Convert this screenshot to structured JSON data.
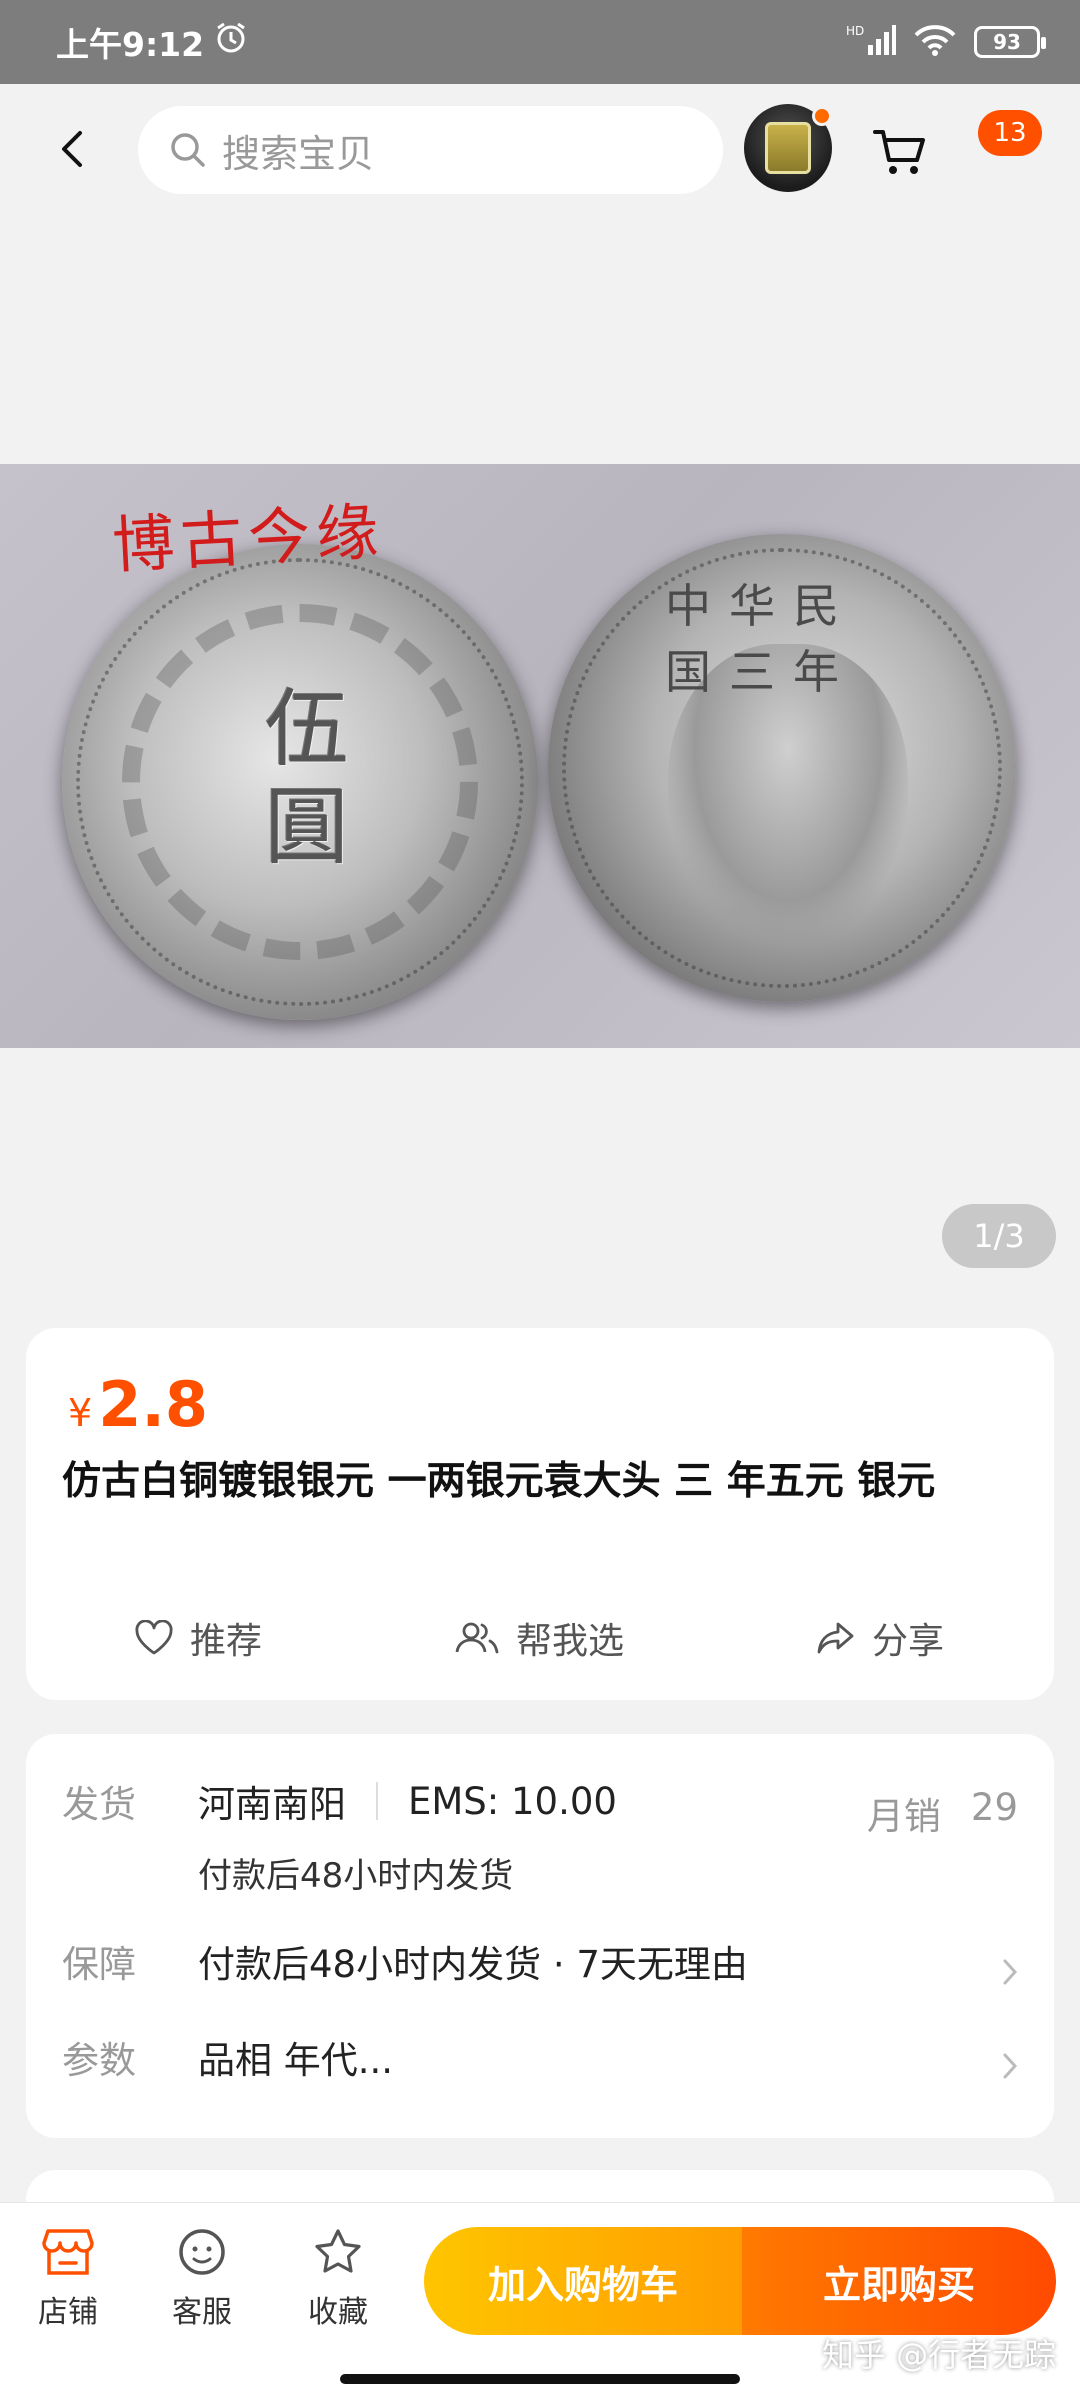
{
  "status_bar": {
    "time": "上午9:12",
    "battery": "93",
    "icons": [
      "alarm-icon",
      "signal-icon",
      "wifi-icon",
      "battery-icon"
    ]
  },
  "header": {
    "search_placeholder": "搜索宝贝",
    "cart_badge": "13",
    "icons": [
      "back-icon",
      "search-icon",
      "cart-icon",
      "more-icon"
    ]
  },
  "gallery": {
    "image_caption": "博古今缘",
    "coin_left_text": "伍圓",
    "coin_right_text": "中华民国三年",
    "page_indicator": "1/3",
    "current_page": 1,
    "total_pages": 3
  },
  "product": {
    "currency": "¥",
    "price": "2.8",
    "title": "仿古白铜镀银银元 一两银元袁大头 三 年五元 银元",
    "accent_color": "#ff5000"
  },
  "actions": [
    {
      "label": "推荐",
      "icon": "heart-icon"
    },
    {
      "label": "帮我选",
      "icon": "people-icon"
    },
    {
      "label": "分享",
      "icon": "share-icon"
    }
  ],
  "info": {
    "shipping_label": "发货",
    "shipping_location": "河南南阳",
    "shipping_fee": "EMS: 10.00",
    "monthly_label": "月销",
    "monthly_value": "29",
    "shipping_note": "付款后48小时内发货",
    "guarantee_label": "保障",
    "guarantee_text": "付款后48小时内发货 · 7天无理由",
    "params_label": "参数",
    "params_text": "品相 年代..."
  },
  "bottom_bar": {
    "store_label": "店铺",
    "service_label": "客服",
    "favorite_label": "收藏",
    "add_to_cart": "加入购物车",
    "buy_now": "立即购买"
  },
  "watermark": "知乎 @行者无踪"
}
